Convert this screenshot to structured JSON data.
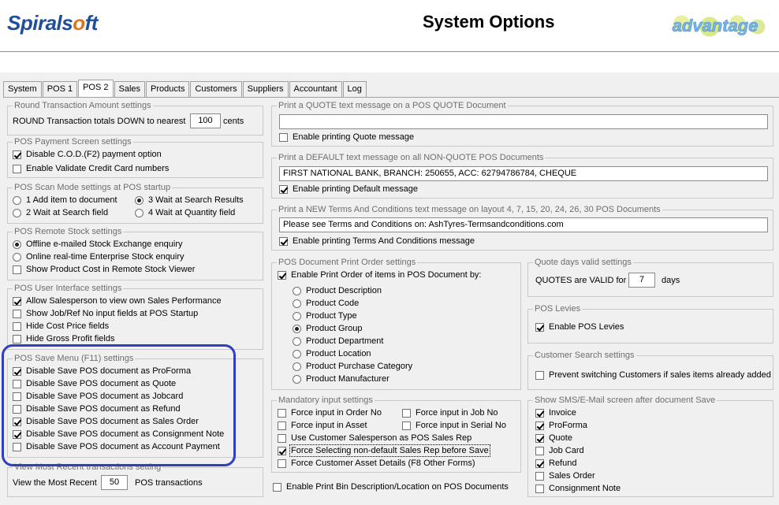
{
  "header": {
    "logo_main": "Spirals",
    "logo_o": "o",
    "logo_end": "ft",
    "title": "System Options",
    "advantage": "advantage"
  },
  "tabs": [
    "System",
    "POS 1",
    "POS 2",
    "Sales",
    "Products",
    "Customers",
    "Suppliers",
    "Accountant",
    "Log"
  ],
  "active_tab": "POS 2",
  "round": {
    "title": "Round Transaction Amount settings",
    "label": "ROUND Transaction totals DOWN to nearest",
    "value": "100",
    "unit": "cents"
  },
  "payment": {
    "title": "POS Payment Screen settings",
    "cod": "Disable C.O.D.(F2) payment option",
    "validate": "Enable Validate Credit Card numbers"
  },
  "scan": {
    "title": "POS Scan Mode settings at POS startup",
    "o1": "1  Add item to document",
    "o2": "2  Wait at Search field",
    "o3": "3  Wait at Search Results",
    "o4": "4  Wait at Quantity field"
  },
  "remote": {
    "title": "POS Remote Stock settings",
    "o1": "Offline e-mailed Stock Exchange enquiry",
    "o2": "Online real-time Enterprise Stock enquiry",
    "o3": "Show Product Cost in Remote Stock Viewer"
  },
  "ui": {
    "title": "POS User Interface settings",
    "o1": "Allow Salesperson to view own Sales Performance",
    "o2": "Show Job/Ref No input fields at POS Startup",
    "o3": "Hide Cost Price fields",
    "o4": "Hide Gross Profit fields"
  },
  "save": {
    "title": "POS Save Menu (F11) settings",
    "o1": "Disable Save POS document as ProForma",
    "o2": "Disable Save POS document as Quote",
    "o3": "Disable Save POS document as Jobcard",
    "o4": "Disable Save POS document as Refund",
    "o5": "Disable Save POS document as Sales Order",
    "o6": "Disable Save POS document as Consignment Note",
    "o7": "Disable Save POS document as Account Payment"
  },
  "recent": {
    "title": "View Most Recent transactions setting",
    "label": "View the Most Recent",
    "value": "50",
    "unit": "POS transactions"
  },
  "quote_msg": {
    "title": "Print a QUOTE text message on a POS QUOTE Document",
    "value": "",
    "enable": "Enable printing Quote message"
  },
  "default_msg": {
    "title": "Print a DEFAULT text message on all NON-QUOTE POS Documents",
    "value": "FIRST NATIONAL BANK, BRANCH: 250655, ACC: 62794786784, CHEQUE",
    "enable": "Enable printing Default message"
  },
  "terms_msg": {
    "title": "Print a NEW Terms And Conditions text message on layout 4, 7, 15, 20, 24, 26, 30 POS Documents",
    "value": "Please see Terms and Conditions on: AshTyres-Termsandconditions.com",
    "enable": "Enable printing Terms And Conditions message"
  },
  "print_order": {
    "title": "POS Document Print Order settings",
    "enable": "Enable Print Order of items in POS Document by:",
    "options": [
      "Product Description",
      "Product Code",
      "Product Type",
      "Product Group",
      "Product Department",
      "Product Location",
      "Product Purchase Category",
      "Product Manufacturer"
    ]
  },
  "mandatory": {
    "title": "Mandatory input settings",
    "order_no": "Force input in Order No",
    "job_no": "Force input in Job No",
    "asset": "Force input in Asset",
    "serial_no": "Force input in Serial No",
    "cust_rep": "Use Customer Salesperson as POS Sales Rep",
    "non_default": "Force Selecting non-default Sales Rep before Save",
    "cust_asset": "Force Customer Asset Details (F8 Other Forms)"
  },
  "bin": {
    "label": "Enable Print Bin Description/Location on POS Documents"
  },
  "quote_days": {
    "title": "Quote days valid settings",
    "label": "QUOTES are VALID for",
    "value": "7",
    "unit": "days"
  },
  "levies": {
    "title": "POS Levies",
    "label": "Enable POS Levies"
  },
  "cust_search": {
    "title": "Customer Search settings",
    "label": "Prevent switching Customers if sales items already added"
  },
  "sms": {
    "title": "Show SMS/E-Mail screen after document Save",
    "options": [
      "Invoice",
      "ProForma",
      "Quote",
      "Job Card",
      "Refund",
      "Sales Order",
      "Consignment Note"
    ]
  }
}
